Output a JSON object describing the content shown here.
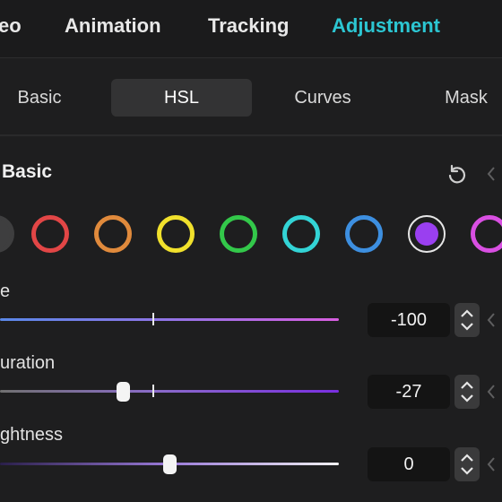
{
  "top_tabs": [
    {
      "label": "eo"
    },
    {
      "label": "Animation"
    },
    {
      "label": "Tracking"
    },
    {
      "label": "Adjustment",
      "active": true
    }
  ],
  "sub_tabs": [
    {
      "label": "Basic"
    },
    {
      "label": "HSL",
      "active": true
    },
    {
      "label": "Curves"
    },
    {
      "label": "Mask"
    }
  ],
  "section": {
    "title": "Basic"
  },
  "colors": {
    "accent": "#2cc6d2",
    "swatches": [
      "#9a9a9a",
      "#e24646",
      "#e08a3c",
      "#f1e12c",
      "#33c84a",
      "#33d4d6",
      "#3d8fe0",
      "#9a3ff0",
      "#d94fe2"
    ],
    "selected_swatch_index": 7
  },
  "sliders": [
    {
      "label": "e",
      "value": "-100",
      "level": 0.0
    },
    {
      "label": "uration",
      "value": "-27",
      "level": 0.365
    },
    {
      "label": "ghtness",
      "value": "0",
      "level": 0.5
    }
  ]
}
